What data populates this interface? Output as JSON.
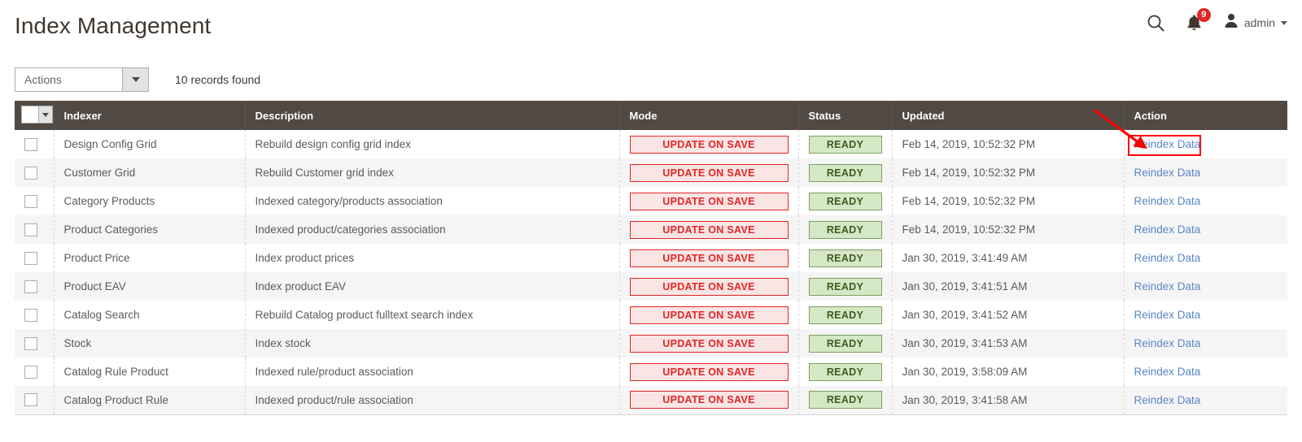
{
  "header": {
    "title": "Index Management",
    "search_icon": "search-icon",
    "notifications_icon": "bell-icon",
    "notifications_count": "9",
    "user_icon": "user-avatar-icon",
    "user_name": "admin",
    "caret_icon": "chevron-down-icon"
  },
  "toolbar": {
    "actions_label": "Actions",
    "actions_caret_icon": "chevron-down-icon",
    "records_found": "10 records found"
  },
  "grid": {
    "select_all_icon": "checkbox-dropdown-icon",
    "columns": [
      "Indexer",
      "Description",
      "Mode",
      "Status",
      "Updated",
      "Action"
    ],
    "rows": [
      {
        "indexer": "Design Config Grid",
        "description": "Rebuild design config grid index",
        "mode": "UPDATE ON SAVE",
        "status": "READY",
        "updated": "Feb 14, 2019, 10:52:32 PM",
        "action": "Reindex Data"
      },
      {
        "indexer": "Customer Grid",
        "description": "Rebuild Customer grid index",
        "mode": "UPDATE ON SAVE",
        "status": "READY",
        "updated": "Feb 14, 2019, 10:52:32 PM",
        "action": "Reindex Data"
      },
      {
        "indexer": "Category Products",
        "description": "Indexed category/products association",
        "mode": "UPDATE ON SAVE",
        "status": "READY",
        "updated": "Feb 14, 2019, 10:52:32 PM",
        "action": "Reindex Data"
      },
      {
        "indexer": "Product Categories",
        "description": "Indexed product/categories association",
        "mode": "UPDATE ON SAVE",
        "status": "READY",
        "updated": "Feb 14, 2019, 10:52:32 PM",
        "action": "Reindex Data"
      },
      {
        "indexer": "Product Price",
        "description": "Index product prices",
        "mode": "UPDATE ON SAVE",
        "status": "READY",
        "updated": "Jan 30, 2019, 3:41:49 AM",
        "action": "Reindex Data"
      },
      {
        "indexer": "Product EAV",
        "description": "Index product EAV",
        "mode": "UPDATE ON SAVE",
        "status": "READY",
        "updated": "Jan 30, 2019, 3:41:51 AM",
        "action": "Reindex Data"
      },
      {
        "indexer": "Catalog Search",
        "description": "Rebuild Catalog product fulltext search index",
        "mode": "UPDATE ON SAVE",
        "status": "READY",
        "updated": "Jan 30, 2019, 3:41:52 AM",
        "action": "Reindex Data"
      },
      {
        "indexer": "Stock",
        "description": "Index stock",
        "mode": "UPDATE ON SAVE",
        "status": "READY",
        "updated": "Jan 30, 2019, 3:41:53 AM",
        "action": "Reindex Data"
      },
      {
        "indexer": "Catalog Rule Product",
        "description": "Indexed rule/product association",
        "mode": "UPDATE ON SAVE",
        "status": "READY",
        "updated": "Jan 30, 2019, 3:58:09 AM",
        "action": "Reindex Data"
      },
      {
        "indexer": "Catalog Product Rule",
        "description": "Indexed product/rule association",
        "mode": "UPDATE ON SAVE",
        "status": "READY",
        "updated": "Jan 30, 2019, 3:41:58 AM",
        "action": "Reindex Data"
      }
    ]
  },
  "annotation": {
    "highlight_target": "Reindex Data",
    "arrow_icon": "red-arrow-annotation",
    "color": "#ff0000"
  },
  "colors": {
    "header_bar": "#514943",
    "mode_badge_bg": "#fae5e5",
    "mode_badge_fg": "#e22626",
    "status_badge_bg": "#d5e8c6",
    "status_badge_fg": "#3f5b20",
    "link": "#5a87c7",
    "notification_badge": "#e22626"
  }
}
